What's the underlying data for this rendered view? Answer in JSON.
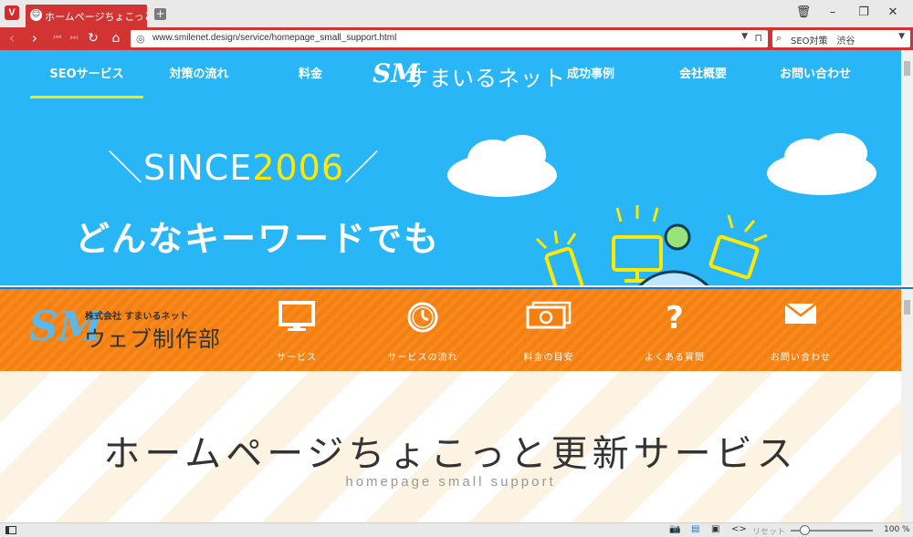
{
  "browser": {
    "tab_title": "ホームページちょこっと更新",
    "url": "www.smilenet.design/service/homepage_small_support.html",
    "search_text": "SEO対策　渋谷",
    "zoom": "100 %",
    "reset_label": "リセット"
  },
  "site1": {
    "nav_left": [
      "SEOサービス",
      "対策の流れ",
      "料金"
    ],
    "logo_text": "すまいるネット",
    "nav_right": [
      "成功事例",
      "会社概要",
      "お問い合わせ"
    ],
    "since_prefix": "＼SINCE",
    "since_year": "2006",
    "since_suffix": "／",
    "hero": "どんなキーワードでも",
    "accent_color": "#ffe900",
    "bg_color": "#29b6f6"
  },
  "site2": {
    "logo_small": "株式会社 すまいるネット",
    "logo_big": "ウェブ制作部",
    "menu": [
      {
        "label": "サービス",
        "icon": "monitor-icon"
      },
      {
        "label": "サービスの流れ",
        "icon": "clock-icon"
      },
      {
        "label": "料金の目安",
        "icon": "money-icon"
      },
      {
        "label": "よくある質問",
        "icon": "question-icon"
      },
      {
        "label": "お問い合わせ",
        "icon": "mail-icon"
      }
    ],
    "hero": "ホームページちょこっと更新サービス",
    "hero_sub": "homepage small support",
    "band_color": "#f5800f"
  }
}
